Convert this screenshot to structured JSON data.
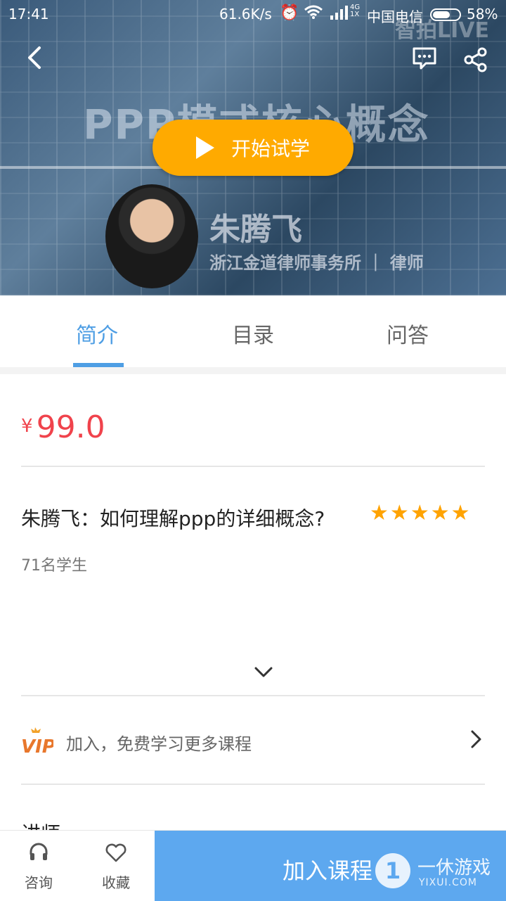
{
  "status_bar": {
    "time": "17:41",
    "net_speed": "61.6K/s",
    "network_type": "4G\n1X",
    "carrier": "中国电信",
    "battery": "58%"
  },
  "hero": {
    "watermark": "智拍LIVE",
    "slide_title": "PPP模式核心概念",
    "play_label": "开始试学",
    "teacher_name": "朱腾飞",
    "teacher_org": "浙江金道律师事务所 ｜ 律师"
  },
  "tabs": [
    {
      "label": "简介",
      "active": true
    },
    {
      "label": "目录",
      "active": false
    },
    {
      "label": "问答",
      "active": false
    }
  ],
  "price": {
    "currency": "¥",
    "value": "99.0"
  },
  "course": {
    "title": "朱腾飞：如何理解ppp的详细概念?",
    "rating": 5,
    "students": "71名学生"
  },
  "vip": {
    "text": "加入，免费学习更多课程"
  },
  "section_lecturer": "讲师",
  "bottom_bar": {
    "consult": "咨询",
    "favorite": "收藏",
    "join": "加入课程"
  },
  "watermark_brand": {
    "cn": "一休游戏",
    "en": "YIXUI.COM"
  },
  "colors": {
    "accent": "#4e9ee4",
    "price": "#f0434c",
    "play": "#ffaa00",
    "star": "#ffa300",
    "join": "#5da8ef"
  }
}
